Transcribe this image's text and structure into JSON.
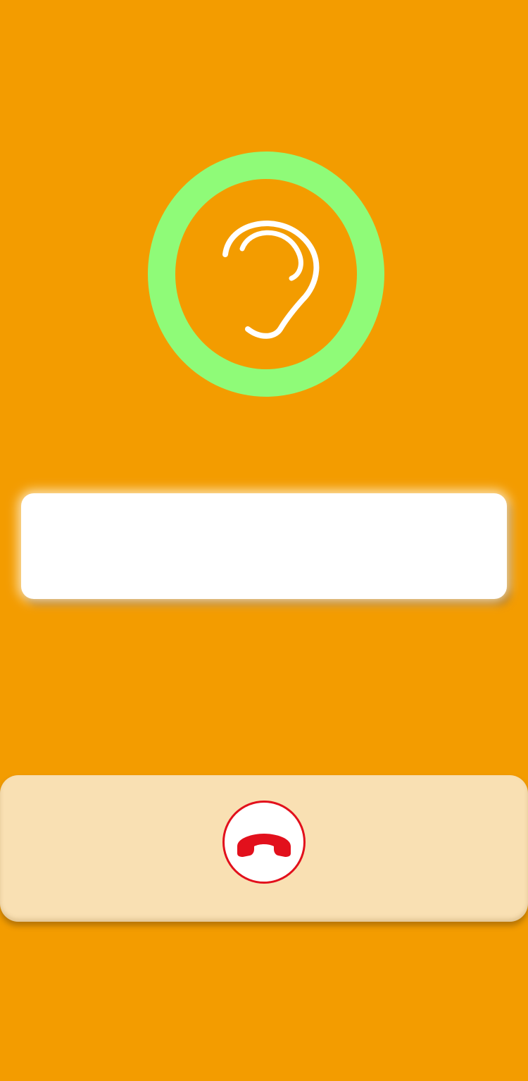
{
  "listen_indicator": {
    "icon": "ear-icon",
    "ring_color": "#8ffb78"
  },
  "message": {
    "text": ""
  },
  "call_controls": {
    "end_call_icon": "phone-hangup-icon",
    "end_call_color": "#e2101c"
  },
  "colors": {
    "background": "#f39c00",
    "bottom_bar": "#f9e0b3"
  }
}
